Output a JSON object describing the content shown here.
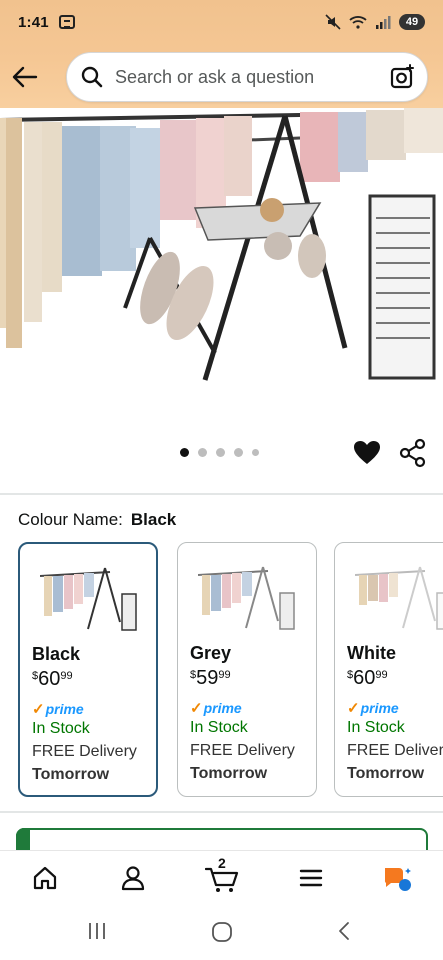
{
  "status_bar": {
    "time": "1:41",
    "battery": "49"
  },
  "header": {
    "search_placeholder": "Search or ask a question",
    "icons": [
      "back-arrow-icon",
      "search-icon",
      "camera-lens-icon"
    ]
  },
  "product": {
    "image_alt": "Foldable clothes drying rack",
    "carousel": {
      "count": 5,
      "active_index": 0
    }
  },
  "colour": {
    "label": "Colour Name:",
    "selected": "Black"
  },
  "variants": [
    {
      "name": "Black",
      "currency": "$",
      "price_whole": "60",
      "price_cents": "99",
      "prime": "prime",
      "stock": "In Stock",
      "delivery": "FREE Delivery",
      "when": "Tomorrow",
      "selected": true
    },
    {
      "name": "Grey",
      "currency": "$",
      "price_whole": "59",
      "price_cents": "99",
      "prime": "prime",
      "stock": "In Stock",
      "delivery": "FREE Delivery",
      "when": "Tomorrow",
      "selected": false
    },
    {
      "name": "White",
      "currency": "$",
      "price_whole": "60",
      "price_cents": "99",
      "prime": "prime",
      "stock": "In Stock",
      "delivery": "FREE Delivery",
      "when": "Tomorrow",
      "selected": false
    }
  ],
  "bottom_nav": {
    "cart_count": "2",
    "items": [
      "home-icon",
      "account-icon",
      "cart-icon",
      "menu-icon",
      "rufus-ai-icon"
    ]
  },
  "colors": {
    "header_bg": "#f5c794",
    "prime_blue": "#1a98ff",
    "in_stock_green": "#007600",
    "selected_border": "#2b5a7a"
  }
}
